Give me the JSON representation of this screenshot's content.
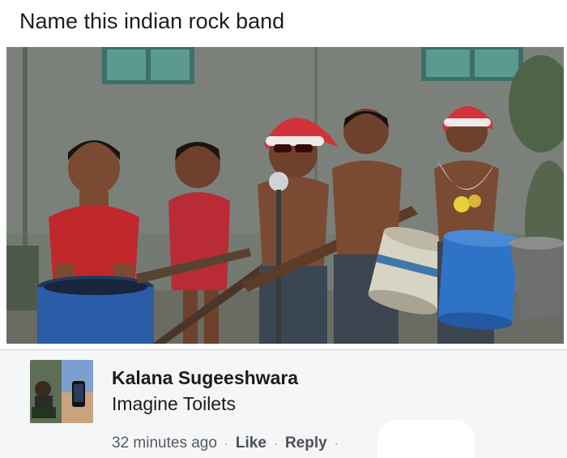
{
  "post": {
    "title": "Name this indian rock band"
  },
  "photo": {
    "icon": "photo-of-children-with-makeshift-instruments"
  },
  "comment": {
    "author": "Kalana Sugeeshwara",
    "text": "Imagine Toilets",
    "time": "32 minutes ago",
    "like_label": "Like",
    "reply_label": "Reply",
    "separator": "·"
  },
  "colors": {
    "comment_bg": "#f5f6f7",
    "author_text": "#1c1c1c",
    "meta_text": "#555a60"
  }
}
